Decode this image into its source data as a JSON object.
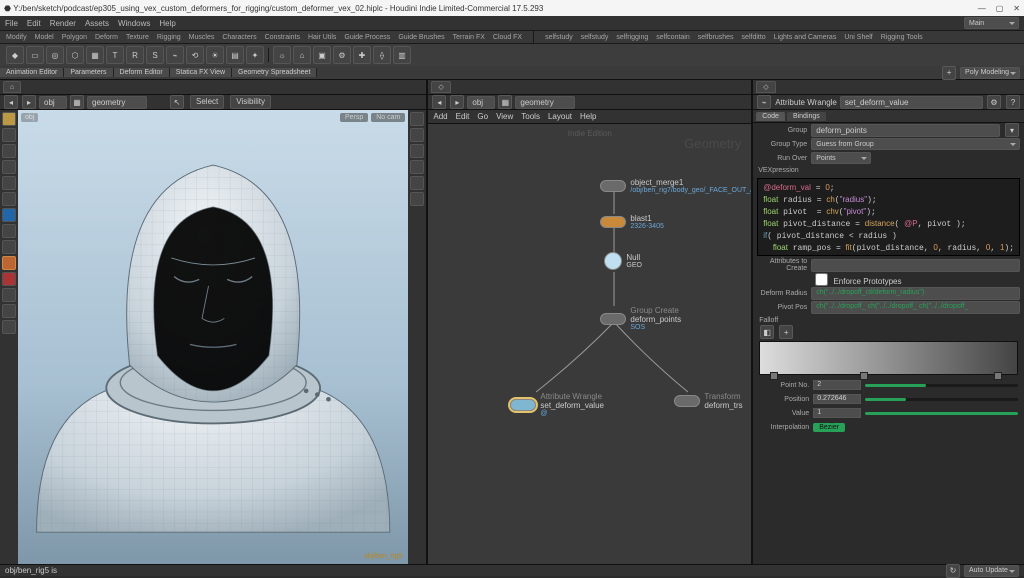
{
  "window": {
    "title": "Y:/ben/sketch/podcast/ep305_using_vex_custom_deformers_for_rigging/custom_deformer_vex_02.hiplc - Houdini Indie Limited-Commercial 17.5.293",
    "buttons": [
      "—",
      "▢",
      "✕"
    ]
  },
  "menu": {
    "items": [
      "File",
      "Edit",
      "Render",
      "Assets",
      "Windows",
      "Help"
    ]
  },
  "shelf": {
    "tabs": [
      "Modify",
      "Model",
      "Polygon",
      "Deform",
      "Texture",
      "Rigging",
      "Muscles",
      "Characters",
      "Constraints",
      "Hair Utils",
      "Guide Process",
      "Guide Brushes",
      "Terrain FX",
      "Cloud FX"
    ],
    "tabs2": [
      "selfstudy",
      "selfstudy",
      "selfrigging",
      "selfcontain",
      "selfbrushes",
      "selfditto",
      "Lights and Cameras",
      "Uni Shelf",
      "Rigging Tools"
    ]
  },
  "desktop": {
    "modes": [
      "Animation Editor",
      "Parameters",
      "Deform Editor",
      "Statica FX View",
      "Geometry Spreadsheet"
    ],
    "right": "Poly Modeling"
  },
  "viewport": {
    "pane_tab_icon": "⌂",
    "path": "obj",
    "context": "geometry",
    "topbar_items": [
      "Select",
      "Visibility"
    ],
    "overlay_tl": "obj",
    "overlay_persp": "Persp",
    "overlay_cam": "No cam",
    "overlay_br": "obj/ben_rig5"
  },
  "network": {
    "tab": "obj",
    "path": "obj",
    "context": "geometry",
    "menu": [
      "Add",
      "Edit",
      "Go",
      "View",
      "Tools",
      "Layout",
      "Help"
    ],
    "indie": "Indie Edition",
    "big": "Geometry",
    "nodes": {
      "n1": {
        "label": "object_merge1",
        "sub": "/obj/ben_rig7/body_geo/_FACE_OUT_/"
      },
      "n2": {
        "label": "blast1",
        "sub": "2326-3405"
      },
      "n3": {
        "label": "Null",
        "sub": "GEO"
      },
      "n4": {
        "top": "Group Create",
        "label": "deform_points",
        "sub": "SOS"
      },
      "n5": {
        "top": "Attribute Wrangle",
        "label": "set_deform_value",
        "sub": "@"
      },
      "n6": {
        "top": "Transform",
        "label": "deform_trs"
      }
    }
  },
  "parms": {
    "title": "Attribute Wrangle",
    "node": "set_deform_value",
    "tabs": [
      "Code",
      "Bindings"
    ],
    "group": {
      "label": "Group",
      "value": "deform_points"
    },
    "grouptype": {
      "label": "Group Type",
      "value": "Guess from Group"
    },
    "runover": {
      "label": "Run Over",
      "value": "Points"
    },
    "vexlabel": "VEXpression",
    "code_lines": [
      "@deform_val = 0;",
      "float radius = ch(\"radius\");",
      "float pivot = chv(\"pivot\");",
      "float pivot_distance = distance( @P, pivot );",
      "if( pivot_distance < radius )",
      "  float ramp_pos = fit(pivot_distance, 0, radius, 0, 1);",
      "};"
    ],
    "attrs_label": "Attributes to Create",
    "enforce": "Enforce Prototypes",
    "deform_radius": {
      "label": "Deform Radius",
      "value": "ch(\"../../dropoff_ctl/deform_radius\")"
    },
    "pivot_pos": {
      "label": "Pivot Pos",
      "value": "ch(\"../../dropoff_  ch(\"../../dropoff_  ch(\"../../dropoff_"
    },
    "falloff": "Falloff",
    "ramp_keys": [
      0.05,
      0.4,
      0.92
    ],
    "point_no": {
      "label": "Point No.",
      "value": "2"
    },
    "position": {
      "label": "Position",
      "value": "0.272646",
      "fill": 27
    },
    "value": {
      "label": "Value",
      "value": "1",
      "fill": 100
    },
    "interp": {
      "label": "Interpolation",
      "value": "Bezier"
    }
  },
  "status": {
    "left": "obj/ben_rig5 is",
    "auto": "Auto Update"
  }
}
